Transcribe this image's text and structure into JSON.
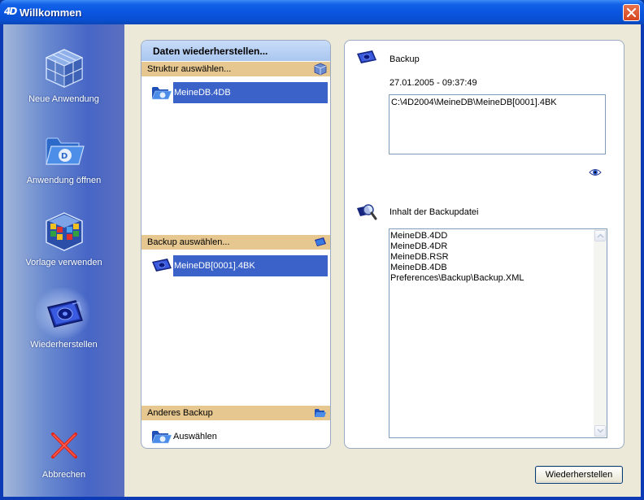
{
  "window": {
    "title": "Willkommen",
    "logo_text": "4D"
  },
  "sidebar": {
    "items": [
      {
        "label": "Neue Anwendung",
        "icon": "cube-icon"
      },
      {
        "label": "Anwendung öffnen",
        "icon": "folder-icon"
      },
      {
        "label": "Vorlage verwenden",
        "icon": "template-cube-icon"
      },
      {
        "label": "Wiederherstellen",
        "icon": "restore-icon",
        "active": true
      },
      {
        "label": "Abbrechen",
        "icon": "red-x-icon"
      }
    ]
  },
  "left_panel": {
    "header": "Daten wiederherstellen...",
    "structure_section": "Struktur auswählen...",
    "structure_item": "MeineDB.4DB",
    "backup_section": "Backup auswählen...",
    "backup_item": "MeineDB[0001].4BK",
    "other_section": "Anderes Backup",
    "other_item": "Auswählen"
  },
  "right_panel": {
    "backup_label": "Backup",
    "backup_date": "27.01.2005 - 09:37:49",
    "backup_path": "C:\\4D2004\\MeineDB\\MeineDB[0001].4BK",
    "contents_label": "Inhalt der Backupdatei",
    "contents": [
      "MeineDB.4DD",
      "MeineDB.4DR",
      "MeineDB.RSR",
      "MeineDB.4DB",
      "Preferences\\Backup\\Backup.XML"
    ]
  },
  "footer": {
    "restore_button": "Wiederherstellen"
  },
  "colors": {
    "titlebar": "#0a55e0",
    "selection": "#3a62c8",
    "section_bar": "#e5c78f",
    "panel_header": "#b6d0f2"
  }
}
